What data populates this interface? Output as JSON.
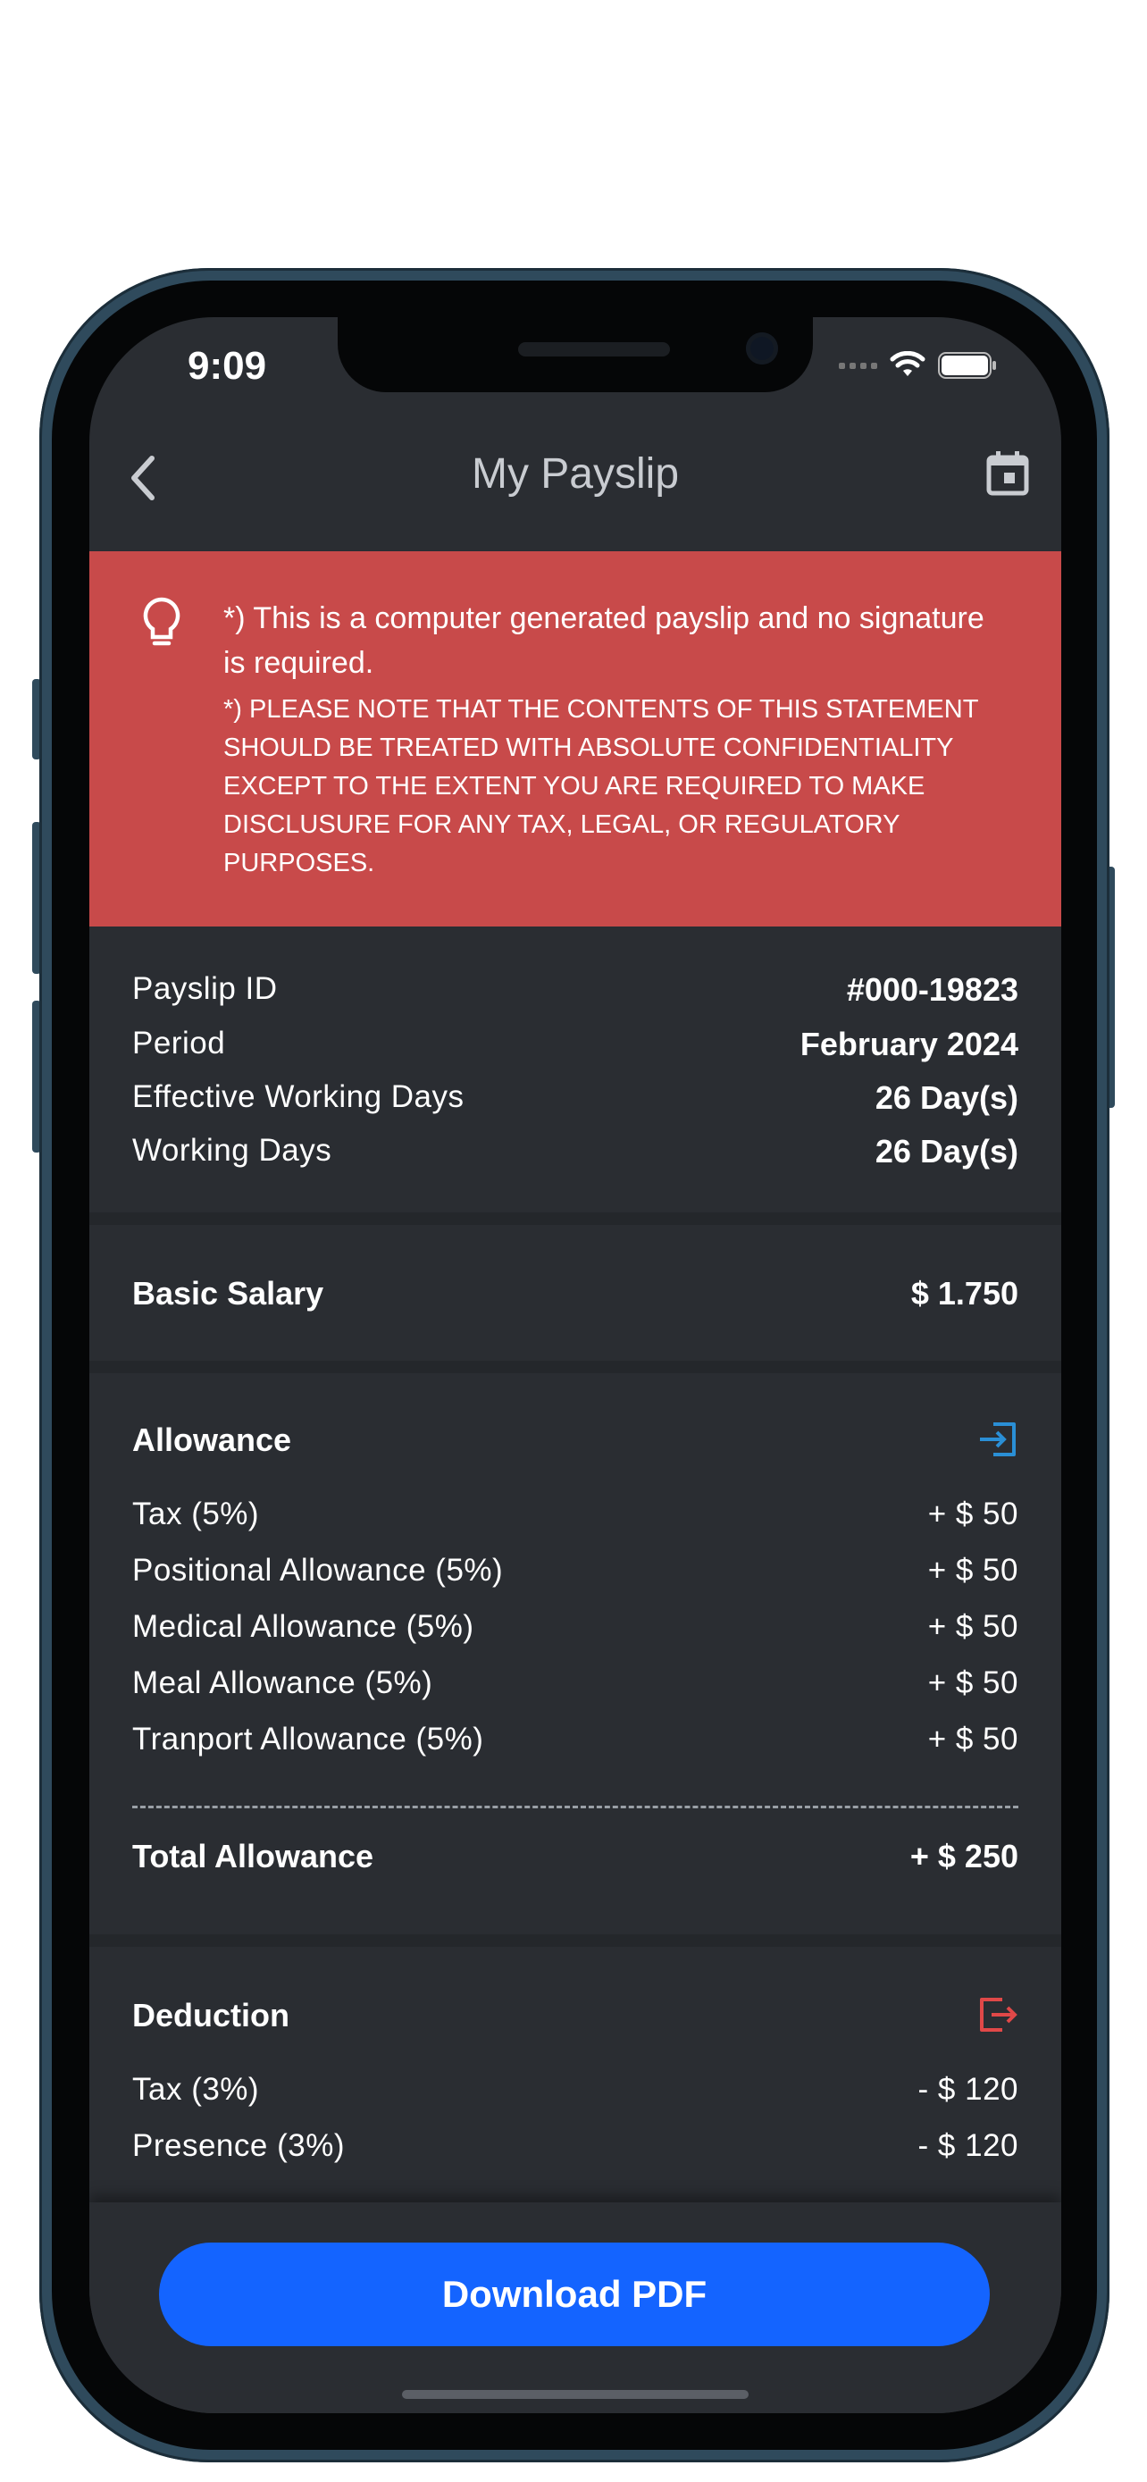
{
  "status_bar": {
    "time": "9:09"
  },
  "header": {
    "title": "My Payslip"
  },
  "notice": {
    "line1": "*) This is a computer generated payslip and no signature is required.",
    "line2": "*) PLEASE NOTE THAT THE CONTENTS OF THIS STATEMENT SHOULD BE TREATED WITH ABSOLUTE CONFIDENTIALITY EXCEPT TO THE EXTENT YOU ARE REQUIRED TO MAKE DISCLUSURE FOR ANY TAX, LEGAL, OR REGULATORY PURPOSES."
  },
  "summary": [
    {
      "label": "Payslip ID",
      "value": "#000-19823"
    },
    {
      "label": "Period",
      "value": "February 2024"
    },
    {
      "label": "Effective Working Days",
      "value": "26 Day(s)"
    },
    {
      "label": "Working Days",
      "value": "26 Day(s)"
    }
  ],
  "basic_salary": {
    "label": "Basic Salary",
    "value": "$ 1.750"
  },
  "allowance": {
    "title": "Allowance",
    "items": [
      {
        "label": "Tax (5%)",
        "value": "+ $ 50"
      },
      {
        "label": "Positional Allowance (5%)",
        "value": "+ $ 50"
      },
      {
        "label": "Medical Allowance (5%)",
        "value": "+ $ 50"
      },
      {
        "label": "Meal Allowance (5%)",
        "value": "+ $ 50"
      },
      {
        "label": "Tranport Allowance (5%)",
        "value": "+ $ 50"
      }
    ],
    "total_label": "Total Allowance",
    "total_value": "+ $ 250"
  },
  "deduction": {
    "title": "Deduction",
    "items": [
      {
        "label": "Tax (3%)",
        "value": "- $ 120"
      },
      {
        "label": "Presence (3%)",
        "value": "- $ 120"
      }
    ]
  },
  "footer": {
    "download_label": "Download PDF"
  },
  "colors": {
    "banner": "#c84a4a",
    "primary": "#1464ff",
    "allowance_icon": "#2a8fd6",
    "deduction_icon": "#e04848"
  }
}
